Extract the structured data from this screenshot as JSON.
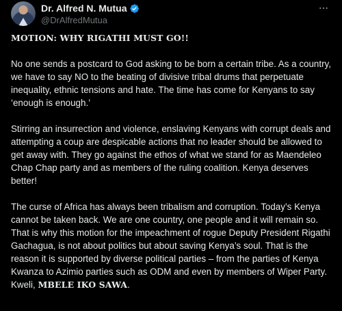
{
  "author": {
    "display_name": "Dr. Alfred N. Mutua",
    "handle": "@DrAlfredMutua",
    "verified": true
  },
  "menu": {
    "more_icon": "ellipsis-horizontal-icon",
    "more_label": "···"
  },
  "post": {
    "headline": "MOTION: WHY RIGATHI MUST GO!!",
    "paragraphs": [
      "No one sends a postcard to God asking to be born a certain tribe. As a country, we have to say NO to the beating of divisive tribal drums that perpetuate inequality, ethnic tensions and hate. The time has come for Kenyans to say ‘enough is enough.’",
      "Stirring an insurrection and violence, enslaving Kenyans with corrupt deals and attempting a coup are despicable actions that no leader should be allowed to get away with. They go against the ethos of what we stand for as Maendeleo Chap Chap party and as members of the ruling coalition. Kenya deserves better!"
    ],
    "last_paragraph_text": "The curse of Africa has always been tribalism and corruption. Today’s Kenya cannot be taken back. We are one country, one people and it will remain so. That is why this motion for the impeachment of rogue Deputy President Rigathi Gachagua, is not about politics but about saving Kenya’s soul. That is the reason it is supported by diverse political parties – from the parties of Kenya Kwanza to Azimio parties such as ODM and even by members of Wiper Party. Kweli, ",
    "closing_bold": "MBELE IKO SAWA",
    "closing_punct": "."
  },
  "colors": {
    "background": "#000000",
    "text": "#e7e9ea",
    "muted": "#71767b",
    "verified_blue": "#1d9bf0"
  }
}
